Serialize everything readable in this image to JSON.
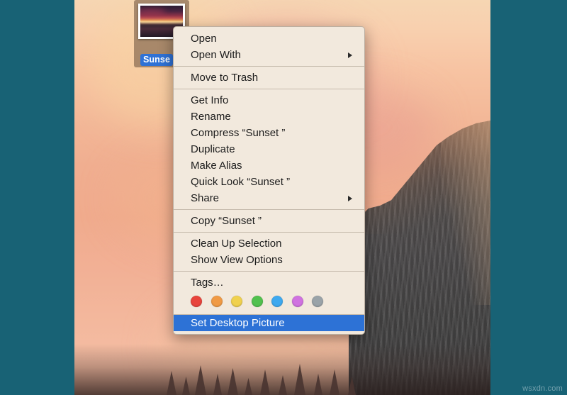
{
  "window": {
    "background_color": "#186275",
    "wallpaper_description": "macOS Yosemite sunset wallpaper with El Capitan cliff"
  },
  "desktop_icon": {
    "name": "icon-sunset",
    "label": "Sunset",
    "label_visible": "Sunse",
    "selected": true,
    "label_highlight_color": "#2f72d6"
  },
  "context_menu": {
    "groups": [
      {
        "items": [
          {
            "label": "Open",
            "submenu": false,
            "highlighted": false
          },
          {
            "label": "Open With",
            "submenu": true,
            "highlighted": false
          }
        ]
      },
      {
        "items": [
          {
            "label": "Move to Trash",
            "submenu": false,
            "highlighted": false
          }
        ]
      },
      {
        "items": [
          {
            "label": "Get Info",
            "submenu": false,
            "highlighted": false
          },
          {
            "label": "Rename",
            "submenu": false,
            "highlighted": false
          },
          {
            "label": "Compress “Sunset ”",
            "submenu": false,
            "highlighted": false
          },
          {
            "label": "Duplicate",
            "submenu": false,
            "highlighted": false
          },
          {
            "label": "Make Alias",
            "submenu": false,
            "highlighted": false
          },
          {
            "label": "Quick Look “Sunset ”",
            "submenu": false,
            "highlighted": false
          },
          {
            "label": "Share",
            "submenu": true,
            "highlighted": false
          }
        ]
      },
      {
        "items": [
          {
            "label": "Copy “Sunset ”",
            "submenu": false,
            "highlighted": false
          }
        ]
      },
      {
        "items": [
          {
            "label": "Clean Up Selection",
            "submenu": false,
            "highlighted": false
          },
          {
            "label": "Show View Options",
            "submenu": false,
            "highlighted": false
          }
        ]
      },
      {
        "items": [
          {
            "label": "Tags…",
            "submenu": false,
            "highlighted": false
          }
        ]
      }
    ],
    "tag_colors": [
      {
        "name": "red",
        "hex": "#e8443c"
      },
      {
        "name": "orange",
        "hex": "#f09a45"
      },
      {
        "name": "yellow",
        "hex": "#f0d14f"
      },
      {
        "name": "green",
        "hex": "#52c14e"
      },
      {
        "name": "blue",
        "hex": "#3fa9ef"
      },
      {
        "name": "purple",
        "hex": "#d072e0"
      },
      {
        "name": "gray",
        "hex": "#9aa3a8"
      }
    ],
    "highlighted_item": {
      "label": "Set Desktop Picture",
      "highlight_color": "#2d72d6"
    },
    "background_color": "#f2e9dd"
  },
  "watermark": {
    "text": "wsxdn.com"
  }
}
